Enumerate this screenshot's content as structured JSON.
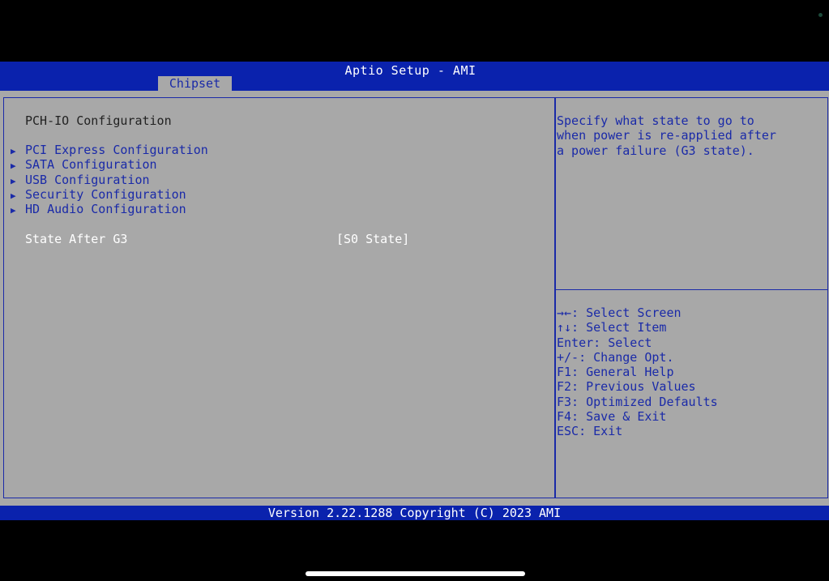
{
  "header": {
    "title": "Aptio Setup - AMI"
  },
  "tabs": [
    {
      "label": "Chipset"
    }
  ],
  "main": {
    "section_title": "PCH-IO Configuration",
    "menu_items": [
      {
        "label": "PCI Express Configuration"
      },
      {
        "label": "SATA Configuration"
      },
      {
        "label": "USB Configuration"
      },
      {
        "label": "Security Configuration"
      },
      {
        "label": "HD Audio Configuration"
      }
    ],
    "setting": {
      "label": "State After G3",
      "value": "[S0 State]"
    }
  },
  "help": {
    "text": "Specify what state to go to\nwhen power is re-applied after\na power failure (G3 state)."
  },
  "keys": [
    "→←: Select Screen",
    "↑↓: Select Item",
    "Enter: Select",
    "+/-: Change Opt.",
    "F1: General Help",
    "F2: Previous Values",
    "F3: Optimized Defaults",
    "F4: Save & Exit",
    "ESC: Exit"
  ],
  "footer": {
    "text": "Version 2.22.1288 Copyright (C) 2023 AMI"
  },
  "icons": {
    "menu_arrow": "submenu-arrow-icon"
  },
  "colors": {
    "bar": "#0a22ad",
    "panel": "#a8a8a8",
    "text_blue": "#1a2aa8",
    "text_white": "#ffffff"
  }
}
